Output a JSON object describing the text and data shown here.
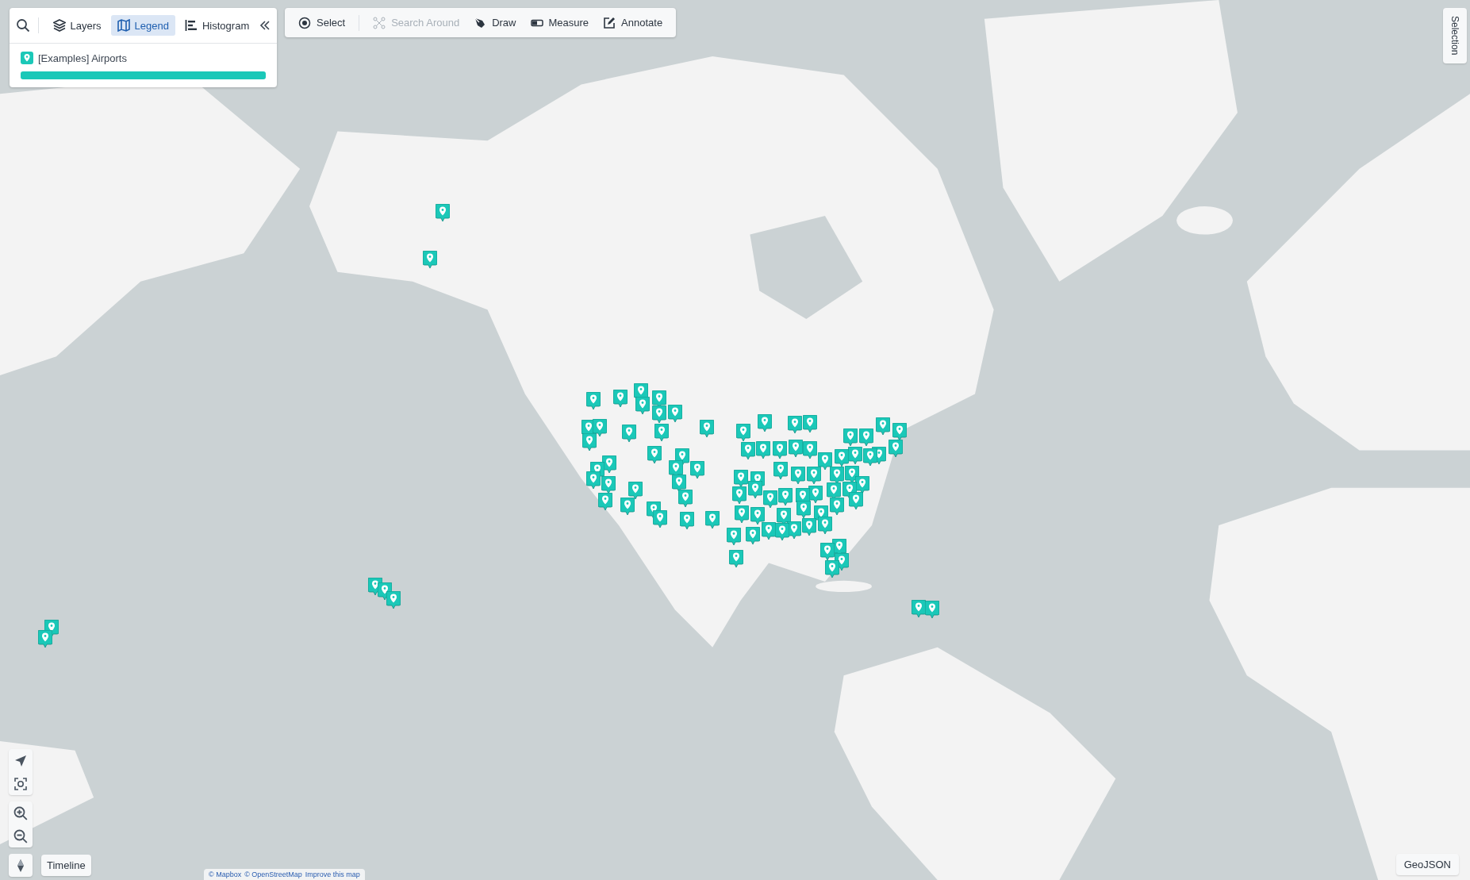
{
  "legend_panel": {
    "tabs": [
      {
        "label": "Layers",
        "selected": false
      },
      {
        "label": "Legend",
        "selected": true
      },
      {
        "label": "Histogram",
        "selected": false
      }
    ],
    "layers": [
      {
        "name": "[Examples] Airports",
        "color": "#1bc8b8"
      }
    ]
  },
  "tools": [
    {
      "label": "Select",
      "disabled": false
    },
    {
      "label": "Search Around",
      "disabled": true
    },
    {
      "label": "Draw",
      "disabled": false
    },
    {
      "label": "Measure",
      "disabled": false
    },
    {
      "label": "Annotate",
      "disabled": false
    }
  ],
  "selection_tab": "Selection",
  "timeline_button": "Timeline",
  "geojson_button": "GeoJSON",
  "attribution": [
    "© Mapbox",
    "© OpenStreetMap",
    "Improve this map"
  ]
}
